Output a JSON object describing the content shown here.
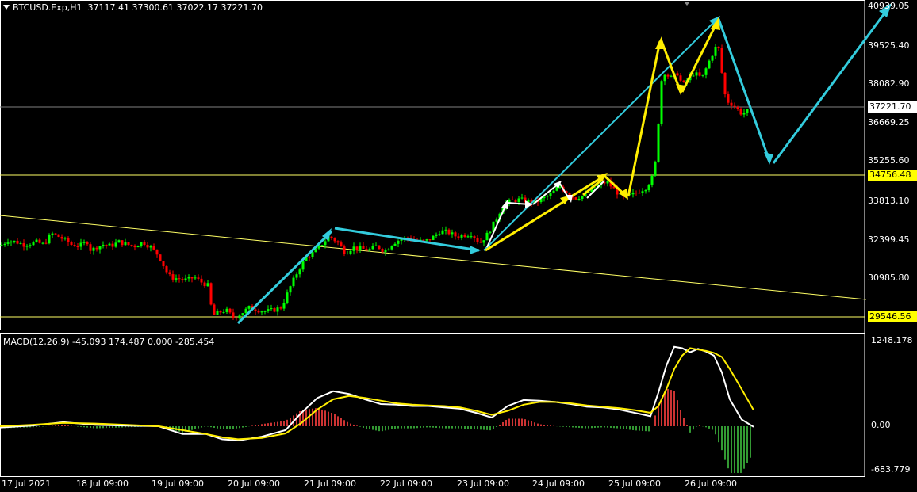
{
  "header": {
    "symbol": "BTCUSD.Exp,H1",
    "ohlc": "37117.41 37300.61 37022.17 37221.70"
  },
  "macd_header": {
    "label": "MACD(12,26,9) -45.093 174.487 0.000 -285.454"
  },
  "price_axis": [
    "40939.05",
    "39525.40",
    "38082.90",
    "36669.25",
    "35255.60",
    "33813.10",
    "32399.45",
    "30985.80"
  ],
  "price_tags": {
    "current": "37221.70",
    "upper_level": "34756.48",
    "lower_level": "29546.56"
  },
  "macd_axis": [
    "1248.178",
    "0.00",
    "-683.779"
  ],
  "time_axis": [
    "17 Jul 2021",
    "18 Jul 09:00",
    "19 Jul 09:00",
    "20 Jul 09:00",
    "21 Jul 09:00",
    "22 Jul 09:00",
    "23 Jul 09:00",
    "24 Jul 09:00",
    "25 Jul 09:00",
    "26 Jul 09:00"
  ],
  "colors": {
    "background": "#000000",
    "bull_candle": "#00ff00",
    "bear_candle": "#ff0000",
    "horizontal_levels": "#ffff66",
    "current_price_line": "#808080",
    "trend_arrows_cyan": "#33ccdd",
    "trend_arrows_yellow": "#ffee00",
    "macd_line": "#ffffff",
    "signal_line": "#ffee00",
    "histogram_positive": "#cc3333",
    "histogram_negative": "#339933"
  },
  "chart_data": {
    "type": "candlestick",
    "price_range": [
      29200,
      41000
    ],
    "horizontal_levels": [
      34756.48,
      29546.56
    ],
    "current_price": 37221.7,
    "macd_range": [
      -683.779,
      1248.178
    ],
    "close_path": [
      [
        0,
        32150
      ],
      [
        10,
        32350
      ],
      [
        20,
        32300
      ],
      [
        30,
        32200
      ],
      [
        40,
        32250
      ],
      [
        45,
        32300
      ],
      [
        55,
        32200
      ],
      [
        65,
        32600
      ],
      [
        70,
        32550
      ],
      [
        80,
        32400
      ],
      [
        90,
        32200
      ],
      [
        100,
        32150
      ],
      [
        110,
        32300
      ],
      [
        115,
        31950
      ],
      [
        120,
        32100
      ],
      [
        130,
        32200
      ],
      [
        140,
        32150
      ],
      [
        150,
        32300
      ],
      [
        160,
        32200
      ],
      [
        170,
        32150
      ],
      [
        180,
        32300
      ],
      [
        190,
        32100
      ],
      [
        200,
        31800
      ],
      [
        210,
        31200
      ],
      [
        215,
        31000
      ],
      [
        225,
        30950
      ],
      [
        235,
        30900
      ],
      [
        245,
        31000
      ],
      [
        255,
        30800
      ],
      [
        262,
        30700
      ],
      [
        268,
        29600
      ],
      [
        275,
        29700
      ],
      [
        285,
        29800
      ],
      [
        295,
        29500
      ],
      [
        305,
        29700
      ],
      [
        315,
        29900
      ],
      [
        325,
        29800
      ],
      [
        335,
        29750
      ],
      [
        345,
        29800
      ],
      [
        355,
        29900
      ],
      [
        365,
        30600
      ],
      [
        375,
        31200
      ],
      [
        385,
        31700
      ],
      [
        395,
        31900
      ],
      [
        405,
        32200
      ],
      [
        415,
        32500
      ],
      [
        425,
        32300
      ],
      [
        435,
        31900
      ],
      [
        445,
        32100
      ],
      [
        455,
        32050
      ],
      [
        465,
        32000
      ],
      [
        475,
        32150
      ],
      [
        485,
        31950
      ],
      [
        495,
        32250
      ],
      [
        505,
        32400
      ],
      [
        515,
        32450
      ],
      [
        525,
        32350
      ],
      [
        535,
        32300
      ],
      [
        545,
        32450
      ],
      [
        555,
        32700
      ],
      [
        565,
        32650
      ],
      [
        575,
        32500
      ],
      [
        585,
        32550
      ],
      [
        595,
        32600
      ],
      [
        605,
        32250
      ],
      [
        615,
        32600
      ],
      [
        625,
        33100
      ],
      [
        635,
        33700
      ],
      [
        645,
        33800
      ],
      [
        655,
        33850
      ],
      [
        665,
        33800
      ],
      [
        675,
        33750
      ],
      [
        685,
        33900
      ],
      [
        695,
        34050
      ],
      [
        705,
        34350
      ],
      [
        715,
        34100
      ],
      [
        725,
        33900
      ],
      [
        735,
        34000
      ],
      [
        745,
        34200
      ],
      [
        755,
        34400
      ],
      [
        765,
        34500
      ],
      [
        775,
        34200
      ],
      [
        785,
        33900
      ],
      [
        795,
        34000
      ],
      [
        805,
        34150
      ],
      [
        815,
        34300
      ],
      [
        825,
        34800
      ],
      [
        830,
        36700
      ],
      [
        835,
        38600
      ],
      [
        845,
        38300
      ],
      [
        855,
        38500
      ],
      [
        860,
        38000
      ],
      [
        865,
        38200
      ],
      [
        875,
        38500
      ],
      [
        885,
        38300
      ],
      [
        895,
        39000
      ],
      [
        905,
        39600
      ],
      [
        910,
        38500
      ],
      [
        915,
        37500
      ],
      [
        925,
        37300
      ],
      [
        935,
        37000
      ],
      [
        945,
        37150
      ],
      [
        950,
        37220
      ]
    ],
    "macd": [
      [
        0,
        -20
      ],
      [
        40,
        10
      ],
      [
        80,
        60
      ],
      [
        120,
        20
      ],
      [
        160,
        10
      ],
      [
        200,
        0
      ],
      [
        230,
        -120
      ],
      [
        260,
        -120
      ],
      [
        280,
        -200
      ],
      [
        300,
        -220
      ],
      [
        330,
        -160
      ],
      [
        360,
        -60
      ],
      [
        380,
        200
      ],
      [
        400,
        420
      ],
      [
        420,
        520
      ],
      [
        440,
        480
      ],
      [
        460,
        400
      ],
      [
        480,
        330
      ],
      [
        500,
        320
      ],
      [
        520,
        300
      ],
      [
        540,
        300
      ],
      [
        560,
        280
      ],
      [
        580,
        260
      ],
      [
        600,
        200
      ],
      [
        620,
        130
      ],
      [
        640,
        300
      ],
      [
        660,
        390
      ],
      [
        680,
        380
      ],
      [
        700,
        360
      ],
      [
        720,
        330
      ],
      [
        740,
        290
      ],
      [
        760,
        280
      ],
      [
        780,
        250
      ],
      [
        800,
        200
      ],
      [
        820,
        150
      ],
      [
        830,
        500
      ],
      [
        840,
        900
      ],
      [
        850,
        1180
      ],
      [
        860,
        1160
      ],
      [
        870,
        1100
      ],
      [
        880,
        1150
      ],
      [
        890,
        1110
      ],
      [
        900,
        1050
      ],
      [
        910,
        800
      ],
      [
        920,
        400
      ],
      [
        935,
        100
      ],
      [
        950,
        -10
      ]
    ],
    "signal": [
      [
        0,
        0
      ],
      [
        40,
        20
      ],
      [
        80,
        50
      ],
      [
        120,
        40
      ],
      [
        160,
        20
      ],
      [
        200,
        0
      ],
      [
        230,
        -60
      ],
      [
        260,
        -120
      ],
      [
        280,
        -170
      ],
      [
        300,
        -200
      ],
      [
        330,
        -180
      ],
      [
        360,
        -110
      ],
      [
        380,
        50
      ],
      [
        400,
        250
      ],
      [
        420,
        400
      ],
      [
        440,
        450
      ],
      [
        460,
        420
      ],
      [
        480,
        380
      ],
      [
        500,
        340
      ],
      [
        520,
        320
      ],
      [
        540,
        310
      ],
      [
        560,
        300
      ],
      [
        580,
        280
      ],
      [
        600,
        230
      ],
      [
        620,
        170
      ],
      [
        640,
        230
      ],
      [
        660,
        320
      ],
      [
        680,
        360
      ],
      [
        700,
        360
      ],
      [
        720,
        340
      ],
      [
        740,
        310
      ],
      [
        760,
        290
      ],
      [
        780,
        270
      ],
      [
        800,
        240
      ],
      [
        820,
        200
      ],
      [
        830,
        300
      ],
      [
        840,
        550
      ],
      [
        850,
        850
      ],
      [
        860,
        1050
      ],
      [
        870,
        1160
      ],
      [
        880,
        1140
      ],
      [
        890,
        1120
      ],
      [
        900,
        1090
      ],
      [
        910,
        1030
      ],
      [
        920,
        850
      ],
      [
        935,
        550
      ],
      [
        950,
        240
      ]
    ]
  }
}
